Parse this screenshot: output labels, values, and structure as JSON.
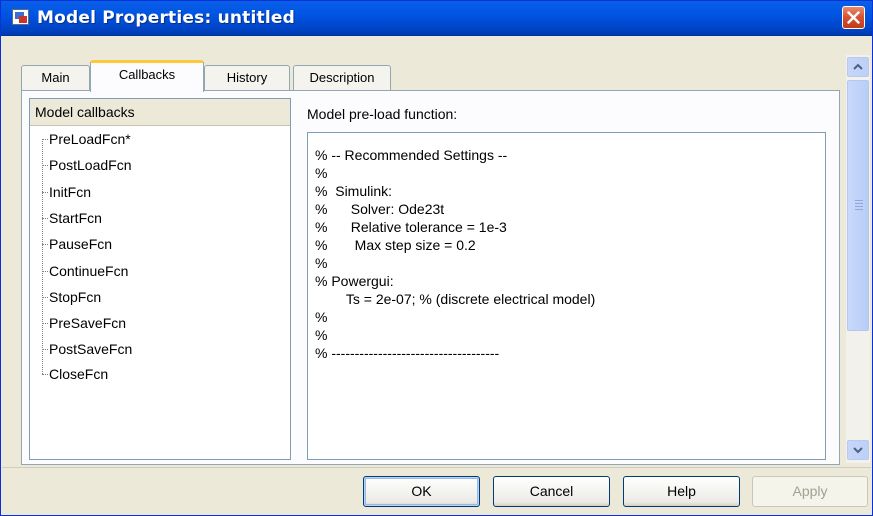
{
  "window": {
    "title": "Model Properties: untitled"
  },
  "tabs": [
    {
      "label": "Main",
      "active": false
    },
    {
      "label": "Callbacks",
      "active": true
    },
    {
      "label": "History",
      "active": false
    },
    {
      "label": "Description",
      "active": false
    }
  ],
  "callbacks_tree": {
    "header": "Model callbacks",
    "items": [
      "PreLoadFcn*",
      "PostLoadFcn",
      "InitFcn",
      "StartFcn",
      "PauseFcn",
      "ContinueFcn",
      "StopFcn",
      "PreSaveFcn",
      "PostSaveFcn",
      "CloseFcn"
    ],
    "selected": "PreLoadFcn*"
  },
  "editor": {
    "label": "Model pre-load function:",
    "lines": [
      "% -- Recommended Settings --",
      "%",
      "%  Simulink:",
      "%      Solver: Ode23t",
      "%      Relative tolerance = 1e-3",
      "%       Max step size = 0.2",
      "%",
      "% Powergui:",
      "        Ts = 2e-07; % (discrete electrical model)",
      "%",
      "%",
      "% ------------------------------------"
    ]
  },
  "buttons": {
    "ok": "OK",
    "cancel": "Cancel",
    "help": "Help",
    "apply": "Apply"
  },
  "colors": {
    "titlebar": "#0054e3",
    "active_tab_accent": "#ffc83c",
    "close_button": "#d65131"
  }
}
